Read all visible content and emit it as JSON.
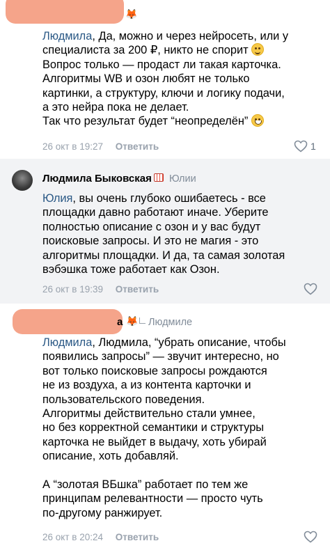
{
  "comments": [
    {
      "mention": "Людмила",
      "lines": [
        ", Да, можно и через нейросеть, или у",
        "специалиста за 200 ₽, никто не спорит",
        "Вопрос только — продаст ли такая карточка.",
        "Алгоритмы WB и озон любят не только",
        "картинки, а структуру, ключи и логику подачи,",
        "а это нейра пока не делает.",
        "Так что результат будет “неопределён”"
      ],
      "date": "26 окт в 19:27",
      "reply_label": "Ответить",
      "likes": "1"
    },
    {
      "author": "Людмила Быковская",
      "reply_to": "Юлии",
      "mention": "Юлия",
      "lines": [
        ", вы очень глубоко ошибаетесь - все",
        "площадки давно работают иначе. Уберите",
        "полностью описание с озон и у вас будут",
        "поисковые запросы. И это не магия - это",
        "алгоритмы площадки. И да, та самая золотая",
        "вэбэшка тоже работает как Озон."
      ],
      "date": "26 окт в 19:39",
      "reply_label": "Ответить"
    },
    {
      "author_suffix": "а",
      "reply_to": "Людмиле",
      "mention": "Людмила",
      "lines": [
        ", Людмила, “убрать описание, чтобы",
        "появились запросы” — звучит интересно, но",
        "вот только поисковые запросы рождаются",
        "не из воздуха, а из контента карточки и",
        "пользовательского поведения.",
        "Алгоритмы действительно стали умнее,",
        "но без корректной семантики и структуры",
        "карточка не выйдет в выдачу, хоть убирай",
        "описание, хоть добавляй.",
        "",
        "А “золотая ВБшка” работает по тем же",
        "принципам релевантности — просто чуть",
        "по-другому ранжирует."
      ],
      "date": "26 окт в 20:24",
      "reply_label": "Ответить"
    }
  ],
  "colors": {
    "link": "#2a5885",
    "meta": "#99a2ad",
    "highlight_bg": "#f2f3f5",
    "redaction": "#f5a48a"
  },
  "icons": [
    "fox-emoji-icon",
    "slightly-smiling-emoji-icon",
    "grinning-emoji-icon",
    "heart-outline-icon",
    "calendar-badge-icon",
    "reply-arrow-icon",
    "avatar"
  ]
}
